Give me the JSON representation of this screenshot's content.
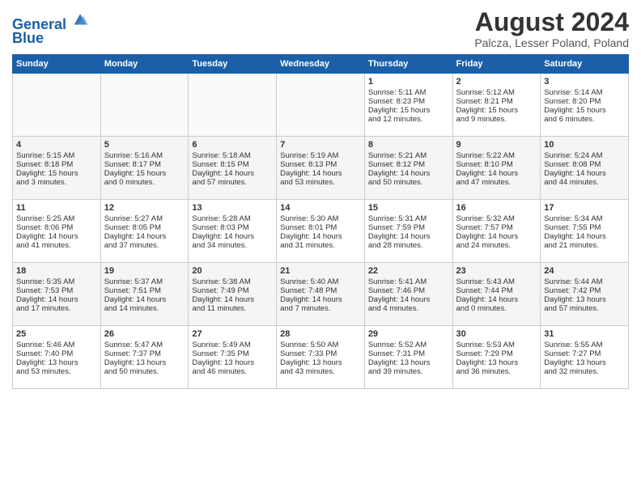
{
  "header": {
    "logo_line1": "General",
    "logo_line2": "Blue",
    "title": "August 2024",
    "subtitle": "Palcza, Lesser Poland, Poland"
  },
  "calendar": {
    "headers": [
      "Sunday",
      "Monday",
      "Tuesday",
      "Wednesday",
      "Thursday",
      "Friday",
      "Saturday"
    ],
    "rows": [
      [
        {
          "day": "",
          "text": ""
        },
        {
          "day": "",
          "text": ""
        },
        {
          "day": "",
          "text": ""
        },
        {
          "day": "",
          "text": ""
        },
        {
          "day": "1",
          "text": "Sunrise: 5:11 AM\nSunset: 8:23 PM\nDaylight: 15 hours\nand 12 minutes."
        },
        {
          "day": "2",
          "text": "Sunrise: 5:12 AM\nSunset: 8:21 PM\nDaylight: 15 hours\nand 9 minutes."
        },
        {
          "day": "3",
          "text": "Sunrise: 5:14 AM\nSunset: 8:20 PM\nDaylight: 15 hours\nand 6 minutes."
        }
      ],
      [
        {
          "day": "4",
          "text": "Sunrise: 5:15 AM\nSunset: 8:18 PM\nDaylight: 15 hours\nand 3 minutes."
        },
        {
          "day": "5",
          "text": "Sunrise: 5:16 AM\nSunset: 8:17 PM\nDaylight: 15 hours\nand 0 minutes."
        },
        {
          "day": "6",
          "text": "Sunrise: 5:18 AM\nSunset: 8:15 PM\nDaylight: 14 hours\nand 57 minutes."
        },
        {
          "day": "7",
          "text": "Sunrise: 5:19 AM\nSunset: 8:13 PM\nDaylight: 14 hours\nand 53 minutes."
        },
        {
          "day": "8",
          "text": "Sunrise: 5:21 AM\nSunset: 8:12 PM\nDaylight: 14 hours\nand 50 minutes."
        },
        {
          "day": "9",
          "text": "Sunrise: 5:22 AM\nSunset: 8:10 PM\nDaylight: 14 hours\nand 47 minutes."
        },
        {
          "day": "10",
          "text": "Sunrise: 5:24 AM\nSunset: 8:08 PM\nDaylight: 14 hours\nand 44 minutes."
        }
      ],
      [
        {
          "day": "11",
          "text": "Sunrise: 5:25 AM\nSunset: 8:06 PM\nDaylight: 14 hours\nand 41 minutes."
        },
        {
          "day": "12",
          "text": "Sunrise: 5:27 AM\nSunset: 8:05 PM\nDaylight: 14 hours\nand 37 minutes."
        },
        {
          "day": "13",
          "text": "Sunrise: 5:28 AM\nSunset: 8:03 PM\nDaylight: 14 hours\nand 34 minutes."
        },
        {
          "day": "14",
          "text": "Sunrise: 5:30 AM\nSunset: 8:01 PM\nDaylight: 14 hours\nand 31 minutes."
        },
        {
          "day": "15",
          "text": "Sunrise: 5:31 AM\nSunset: 7:59 PM\nDaylight: 14 hours\nand 28 minutes."
        },
        {
          "day": "16",
          "text": "Sunrise: 5:32 AM\nSunset: 7:57 PM\nDaylight: 14 hours\nand 24 minutes."
        },
        {
          "day": "17",
          "text": "Sunrise: 5:34 AM\nSunset: 7:55 PM\nDaylight: 14 hours\nand 21 minutes."
        }
      ],
      [
        {
          "day": "18",
          "text": "Sunrise: 5:35 AM\nSunset: 7:53 PM\nDaylight: 14 hours\nand 17 minutes."
        },
        {
          "day": "19",
          "text": "Sunrise: 5:37 AM\nSunset: 7:51 PM\nDaylight: 14 hours\nand 14 minutes."
        },
        {
          "day": "20",
          "text": "Sunrise: 5:38 AM\nSunset: 7:49 PM\nDaylight: 14 hours\nand 11 minutes."
        },
        {
          "day": "21",
          "text": "Sunrise: 5:40 AM\nSunset: 7:48 PM\nDaylight: 14 hours\nand 7 minutes."
        },
        {
          "day": "22",
          "text": "Sunrise: 5:41 AM\nSunset: 7:46 PM\nDaylight: 14 hours\nand 4 minutes."
        },
        {
          "day": "23",
          "text": "Sunrise: 5:43 AM\nSunset: 7:44 PM\nDaylight: 14 hours\nand 0 minutes."
        },
        {
          "day": "24",
          "text": "Sunrise: 5:44 AM\nSunset: 7:42 PM\nDaylight: 13 hours\nand 57 minutes."
        }
      ],
      [
        {
          "day": "25",
          "text": "Sunrise: 5:46 AM\nSunset: 7:40 PM\nDaylight: 13 hours\nand 53 minutes."
        },
        {
          "day": "26",
          "text": "Sunrise: 5:47 AM\nSunset: 7:37 PM\nDaylight: 13 hours\nand 50 minutes."
        },
        {
          "day": "27",
          "text": "Sunrise: 5:49 AM\nSunset: 7:35 PM\nDaylight: 13 hours\nand 46 minutes."
        },
        {
          "day": "28",
          "text": "Sunrise: 5:50 AM\nSunset: 7:33 PM\nDaylight: 13 hours\nand 43 minutes."
        },
        {
          "day": "29",
          "text": "Sunrise: 5:52 AM\nSunset: 7:31 PM\nDaylight: 13 hours\nand 39 minutes."
        },
        {
          "day": "30",
          "text": "Sunrise: 5:53 AM\nSunset: 7:29 PM\nDaylight: 13 hours\nand 36 minutes."
        },
        {
          "day": "31",
          "text": "Sunrise: 5:55 AM\nSunset: 7:27 PM\nDaylight: 13 hours\nand 32 minutes."
        }
      ]
    ]
  }
}
